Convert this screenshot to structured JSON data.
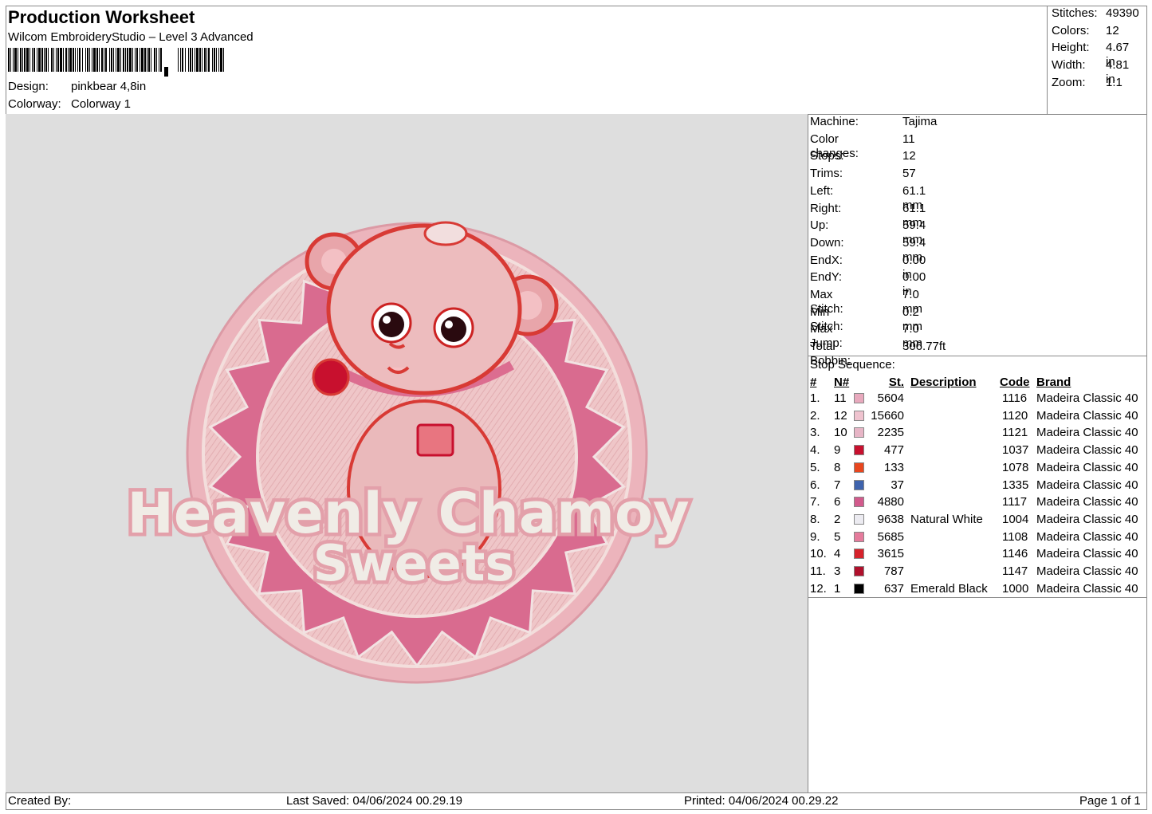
{
  "header": {
    "title": "Production Worksheet",
    "software": "Wilcom EmbroideryStudio – Level 3 Advanced",
    "design_label": "Design:",
    "design_value": "pinkbear 4,8in",
    "colorway_label": "Colorway:",
    "colorway_value": "Colorway 1"
  },
  "stats": [
    {
      "label": "Stitches:",
      "value": "49390"
    },
    {
      "label": "Colors:",
      "value": "12"
    },
    {
      "label": "Height:",
      "value": "4.67 in"
    },
    {
      "label": "Width:",
      "value": "4.81 in"
    },
    {
      "label": "Zoom:",
      "value": "1:1"
    }
  ],
  "machine_info": [
    {
      "label": "Machine:",
      "value": "Tajima"
    },
    {
      "label": "Color changes:",
      "value": "11"
    },
    {
      "label": "Stops:",
      "value": "12"
    },
    {
      "label": "Trims:",
      "value": "57"
    },
    {
      "label": "Left:",
      "value": "61.1 mm"
    },
    {
      "label": "Right:",
      "value": "61.1 mm"
    },
    {
      "label": "Up:",
      "value": "59.4 mm"
    },
    {
      "label": "Down:",
      "value": "59.4 mm"
    },
    {
      "label": "EndX:",
      "value": "0.00 in"
    },
    {
      "label": "EndY:",
      "value": "0.00 in"
    },
    {
      "label": "Max Stitch:",
      "value": "7.0 mm"
    },
    {
      "label": "Min Stitch:",
      "value": "0.2 mm"
    },
    {
      "label": "Max Jump:",
      "value": "7.0 mm"
    },
    {
      "label": "Total Bobbin:",
      "value": "306.77ft"
    }
  ],
  "stop_sequence": {
    "title": "Stop Sequence:",
    "headers": {
      "num": "#",
      "n": "N#",
      "st": "St.",
      "desc": "Description",
      "code": "Code",
      "brand": "Brand"
    },
    "rows": [
      {
        "num": "1.",
        "n": "11",
        "color": "#e8a9bd",
        "st": "5604",
        "desc": "",
        "code": "1116",
        "brand": "Madeira Classic 40"
      },
      {
        "num": "2.",
        "n": "12",
        "color": "#efc3cf",
        "st": "15660",
        "desc": "",
        "code": "1120",
        "brand": "Madeira Classic 40"
      },
      {
        "num": "3.",
        "n": "10",
        "color": "#e7b5c6",
        "st": "2235",
        "desc": "",
        "code": "1121",
        "brand": "Madeira Classic 40"
      },
      {
        "num": "4.",
        "n": "9",
        "color": "#c8102e",
        "st": "477",
        "desc": "",
        "code": "1037",
        "brand": "Madeira Classic 40"
      },
      {
        "num": "5.",
        "n": "8",
        "color": "#e8461e",
        "st": "133",
        "desc": "",
        "code": "1078",
        "brand": "Madeira Classic 40"
      },
      {
        "num": "6.",
        "n": "7",
        "color": "#3e63ad",
        "st": "37",
        "desc": "",
        "code": "1335",
        "brand": "Madeira Classic 40"
      },
      {
        "num": "7.",
        "n": "6",
        "color": "#d25a8c",
        "st": "4880",
        "desc": "",
        "code": "1117",
        "brand": "Madeira Classic 40"
      },
      {
        "num": "8.",
        "n": "2",
        "color": "#ecebf1",
        "st": "9638",
        "desc": "Natural White",
        "code": "1004",
        "brand": "Madeira Classic 40"
      },
      {
        "num": "9.",
        "n": "5",
        "color": "#e57b9c",
        "st": "5685",
        "desc": "",
        "code": "1108",
        "brand": "Madeira Classic 40"
      },
      {
        "num": "10.",
        "n": "4",
        "color": "#d6222b",
        "st": "3615",
        "desc": "",
        "code": "1146",
        "brand": "Madeira Classic 40"
      },
      {
        "num": "11.",
        "n": "3",
        "color": "#b0102c",
        "st": "787",
        "desc": "",
        "code": "1147",
        "brand": "Madeira Classic 40"
      },
      {
        "num": "12.",
        "n": "1",
        "color": "#000000",
        "st": "637",
        "desc": "Emerald Black",
        "code": "1000",
        "brand": "Madeira Classic 40"
      }
    ]
  },
  "design_preview": {
    "text_line1": "Heavenly Chamoy",
    "text_line2": "Sweets"
  },
  "footer": {
    "created_by": "Created By:",
    "last_saved": "Last Saved: 04/06/2024 00.29.19",
    "printed": "Printed: 04/06/2024 00.29.22",
    "page": "Page 1 of 1"
  }
}
